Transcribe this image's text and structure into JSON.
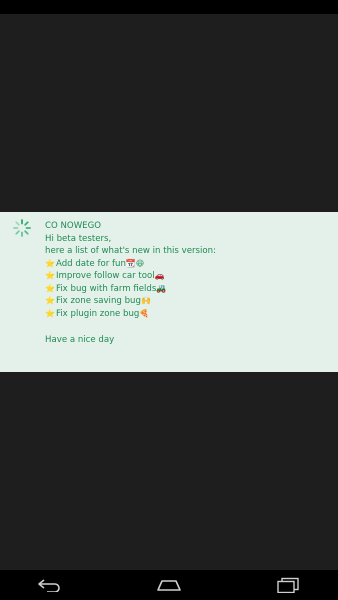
{
  "dialog": {
    "title": "CO NOWEGO",
    "greeting": "Hi beta testers,",
    "intro": "here a list of what's new in this version:",
    "items": [
      {
        "bullet": "⭐",
        "text": "Add date for fun",
        "emoji": "📆😆"
      },
      {
        "bullet": "⭐",
        "text": "Improve follow car tool",
        "emoji": "🚗"
      },
      {
        "bullet": "⭐",
        "text": "Fix bug with farm fields",
        "emoji": "🚜"
      },
      {
        "bullet": "⭐",
        "text": "Fix zone saving bug",
        "emoji": "🙌"
      },
      {
        "bullet": "⭐",
        "text": "Fix plugin zone bug",
        "emoji": "🍕"
      }
    ],
    "closing": "Have a nice day"
  },
  "colors": {
    "background": "#1e1e1e",
    "dialog_background": "#e3f1ea",
    "text": "#1f8a52",
    "accent": "#2aa96a",
    "bars": "#000000"
  },
  "icons": {
    "spinner": "loading-spinner-icon",
    "back": "back-arrow-icon",
    "home": "home-icon",
    "recents": "recent-apps-icon"
  }
}
